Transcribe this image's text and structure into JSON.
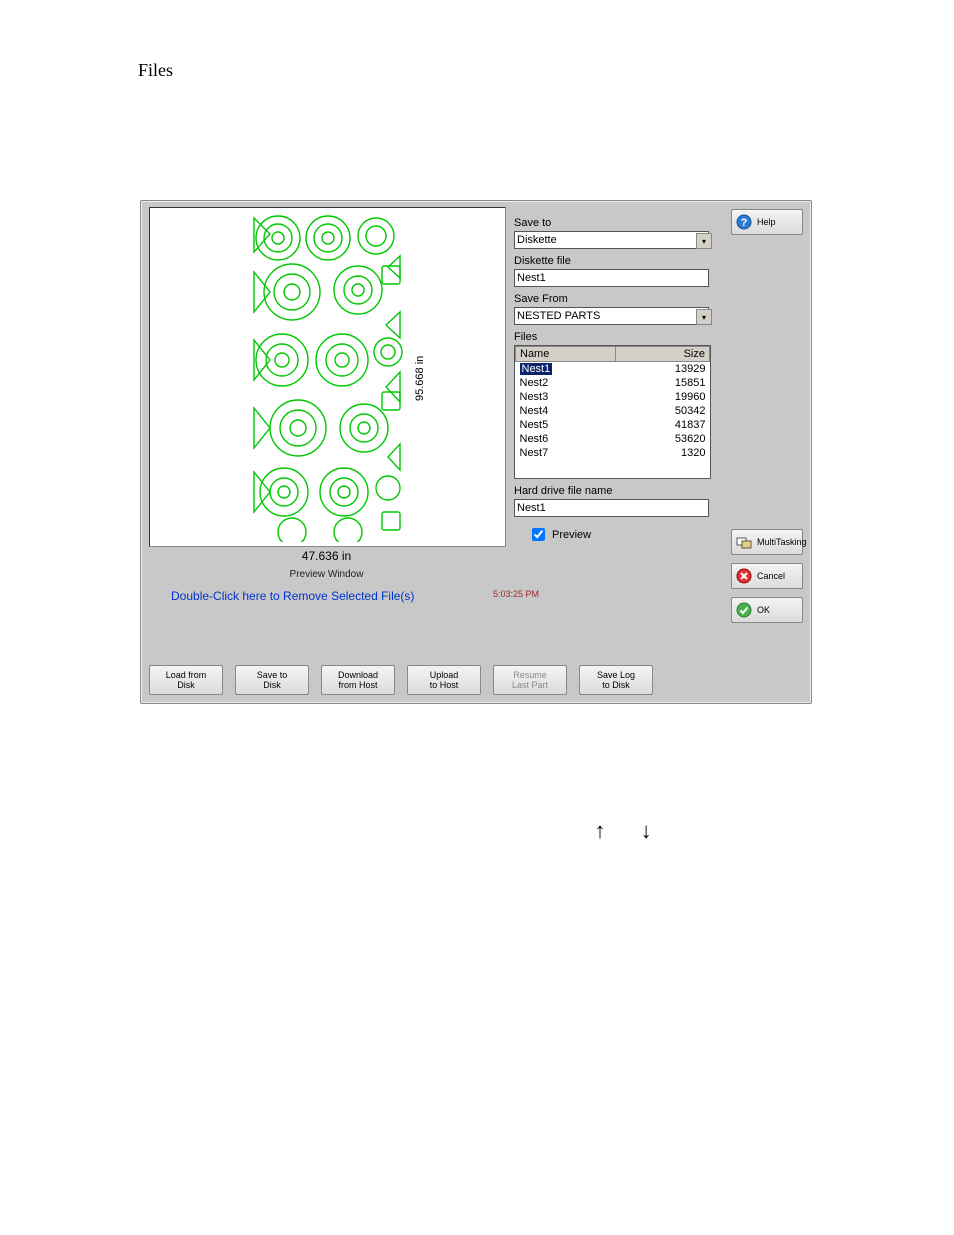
{
  "page": {
    "title": "Files"
  },
  "preview": {
    "width_label": "47.636 in",
    "height_label": "95.668 in",
    "caption": "Preview Window",
    "remove_hint": "Double-Click here to Remove Selected File(s)",
    "clock": "5:03:25 PM"
  },
  "form": {
    "save_to_label": "Save to",
    "save_to_value": "Diskette",
    "diskette_file_label": "Diskette file",
    "diskette_file_value": "Nest1",
    "save_from_label": "Save From",
    "save_from_value": "NESTED PARTS",
    "files_label": "Files",
    "columns": {
      "name": "Name",
      "size": "Size"
    },
    "files": [
      {
        "name": "Nest1",
        "size": "13929",
        "selected": true
      },
      {
        "name": "Nest2",
        "size": "15851"
      },
      {
        "name": "Nest3",
        "size": "19960"
      },
      {
        "name": "Nest4",
        "size": "50342"
      },
      {
        "name": "Nest5",
        "size": "41837"
      },
      {
        "name": "Nest6",
        "size": "53620"
      },
      {
        "name": "Nest7",
        "size": "1320"
      }
    ],
    "hd_filename_label": "Hard drive file name",
    "hd_filename_value": "Nest1",
    "preview_chk_label": "Preview",
    "preview_chk_checked": true
  },
  "side": {
    "help": "Help",
    "multitask": "MultiTasking",
    "cancel": "Cancel",
    "ok": "OK"
  },
  "bottom": {
    "load": {
      "l1": "Load from",
      "l2": "Disk"
    },
    "save": {
      "l1": "Save to",
      "l2": "Disk"
    },
    "download": {
      "l1": "Download",
      "l2": "from Host"
    },
    "upload": {
      "l1": "Upload",
      "l2": "to Host"
    },
    "resume": {
      "l1": "Resume",
      "l2": "Last Part"
    },
    "savelog": {
      "l1": "Save Log",
      "l2": "to Disk"
    }
  },
  "arrows": {
    "up": "↑",
    "down": "↓"
  }
}
